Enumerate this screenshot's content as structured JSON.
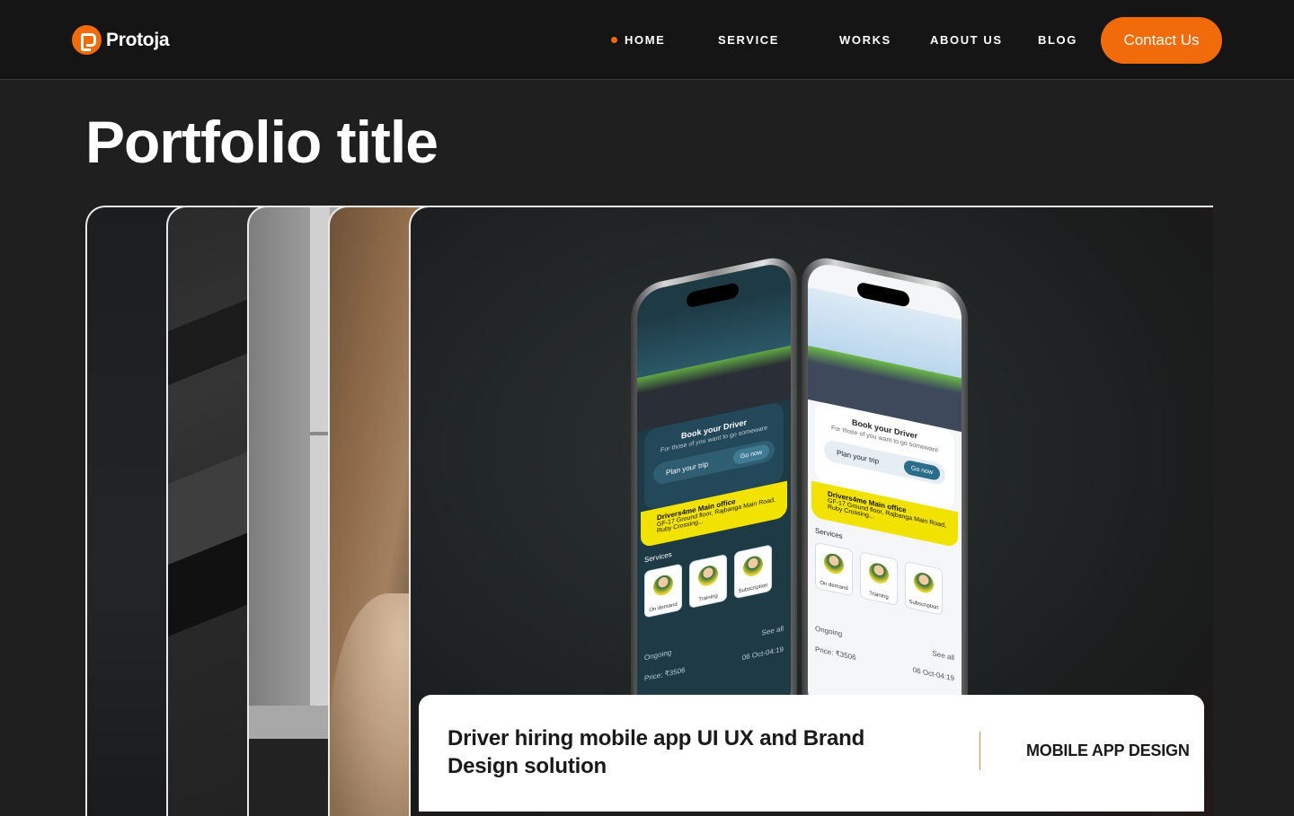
{
  "brand": {
    "name": "Protoja",
    "accent_color": "#f26b0a"
  },
  "nav": {
    "items": [
      {
        "label": "HOME",
        "active": true
      },
      {
        "label": "SERVICE",
        "active": false
      },
      {
        "label": "WORKS",
        "active": false
      },
      {
        "label": "ABOUT US",
        "active": false
      },
      {
        "label": "BLOG",
        "active": false
      }
    ],
    "cta_label": "Contact Us"
  },
  "page": {
    "title": "Portfolio title"
  },
  "featured": {
    "title": "Driver hiring mobile app UI UX and Brand Design solution",
    "category": "MOBILE APP DESIGN",
    "mockup": {
      "heading": "Book your Driver",
      "subheading": "For those of you want to go someware",
      "plan_label": "Plan your trip",
      "go_label": "Go now",
      "office_name": "Drivers4me Main office",
      "office_address": "GF-17 Ground floor, Rajbanga Main Road, Ruby Crossing...",
      "services_label": "Services",
      "services": [
        "On demand",
        "Training",
        "Subscription"
      ],
      "see_all": "See all",
      "ongoing_label": "Ongoing",
      "price": "Price: ₹3506",
      "date": "06 Oct-04:19"
    }
  }
}
